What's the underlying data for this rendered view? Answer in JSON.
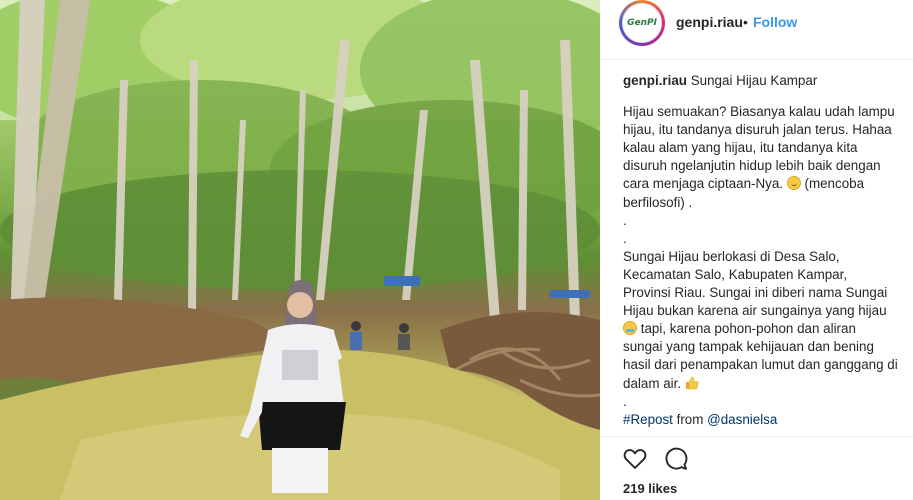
{
  "post": {
    "account": {
      "username": "genpi.riau",
      "separator": "•",
      "follow_label": "Follow",
      "avatar_icon": "genpi-logo-icon",
      "avatar_text": "GenPI"
    },
    "caption": {
      "username": "genpi.riau",
      "title": "Sungai Hijau Kampar",
      "paragraph1": "Hijau semuakan? Biasanya kalau udah lampu hijau, itu tandanya disuruh jalan terus. Hahaa kalau alam yang hijau, itu tandanya kita disuruh ngelanjutin hidup lebih baik dengan cara menjaga ciptaan-Nya.",
      "paragraph1_tail": "(mencoba berfilosofi) .",
      "dot1": ".",
      "dot2": ".",
      "paragraph2_a": "Sungai Hijau berlokasi di Desa Salo, Kecamatan Salo, Kabupaten Kampar, Provinsi Riau. Sungai ini diberi nama Sungai Hijau bukan karena air sungainya yang hijau",
      "paragraph2_b": "tapi, karena pohon-pohon dan aliran sungai yang tampak kehijauan dan bening hasil dari penampakan lumut dan ganggang di dalam air.",
      "dot3": ".",
      "repost_tag": "#Repost",
      "repost_from": "from",
      "repost_mention": "@dasnielsa",
      "emoji_1": "smiling-face-icon",
      "emoji_2": "sweat-face-icon",
      "emoji_3": "thumbs-up-icon"
    },
    "actions": {
      "like_icon": "heart-icon",
      "comment_icon": "comment-icon"
    },
    "likes_text": "219 likes"
  },
  "colors": {
    "link": "#3897f0",
    "hashtag": "#003569",
    "text": "#262626",
    "divider": "#efefef"
  }
}
